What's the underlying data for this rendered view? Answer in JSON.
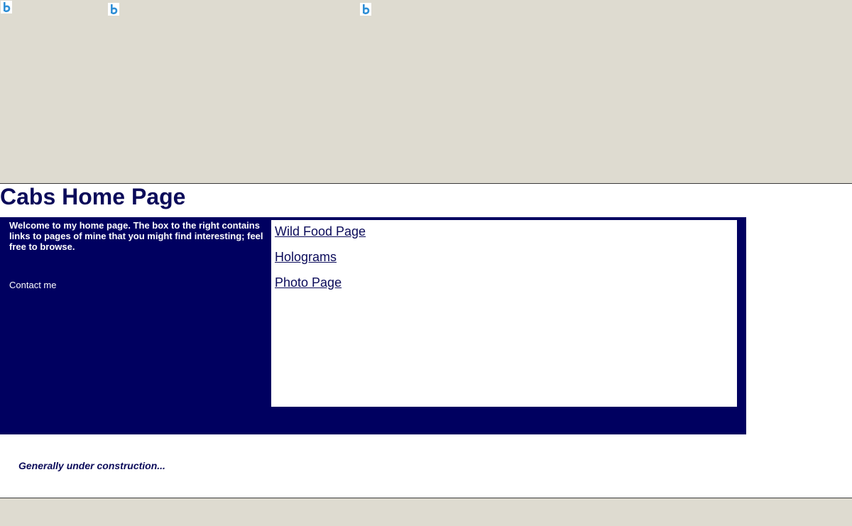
{
  "header": {
    "icons": [
      "bing-b-icon",
      "bing-b-icon",
      "bing-b-icon"
    ]
  },
  "page": {
    "title": "Cabs Home Page"
  },
  "panel": {
    "welcome": "Welcome to my home page. The box to the right contains links to pages of mine that you might find interesting; feel free to browse.",
    "contact_label": "Contact me",
    "links": [
      {
        "label": "Wild Food Page"
      },
      {
        "label": "Holograms"
      },
      {
        "label": "Photo Page"
      }
    ]
  },
  "footer": {
    "note": "Generally under construction..."
  },
  "colors": {
    "band": "#dedbd0",
    "panel": "#000060",
    "heading": "#0b0b5a",
    "icon": "#2f8fd6"
  }
}
